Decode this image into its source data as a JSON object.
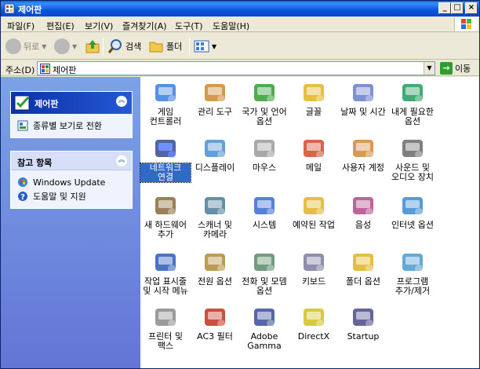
{
  "window": {
    "title": "제어판"
  },
  "menu": [
    "파일(F)",
    "편집(E)",
    "보기(V)",
    "즐겨찾기(A)",
    "도구(T)",
    "도움말(H)"
  ],
  "toolbar": {
    "back": "뒤로",
    "search": "검색",
    "folders": "폴더"
  },
  "address": {
    "label": "주소(D)",
    "value": "제어판",
    "go": "이동"
  },
  "sidebar": {
    "panel1": {
      "title": "제어판",
      "link": "종류별 보기로 전환"
    },
    "panel2": {
      "title": "참고 항목",
      "links": [
        "Windows Update",
        "도움말 및 지원"
      ]
    }
  },
  "items": [
    {
      "label": "게임\n컨트롤러",
      "icon": "game-controller-icon"
    },
    {
      "label": "관리 도구",
      "icon": "admin-tools-icon"
    },
    {
      "label": "국가 및 언어\n옵션",
      "icon": "globe-icon"
    },
    {
      "label": "글꼴",
      "icon": "fonts-folder-icon"
    },
    {
      "label": "날짜 및 시간",
      "icon": "clock-icon"
    },
    {
      "label": "내게 필요한\n옵션",
      "icon": "accessibility-icon"
    },
    {
      "label": "네트워크\n연결",
      "icon": "network-globe-icon",
      "selected": true
    },
    {
      "label": "디스플레이",
      "icon": "display-icon"
    },
    {
      "label": "마우스",
      "icon": "mouse-icon"
    },
    {
      "label": "메일",
      "icon": "mail-icon"
    },
    {
      "label": "사용자 계정",
      "icon": "user-accounts-icon"
    },
    {
      "label": "사운드 및\n오디오 장치",
      "icon": "speaker-icon"
    },
    {
      "label": "새 하드웨어\n추가",
      "icon": "add-hardware-icon"
    },
    {
      "label": "스캐너 및\n카메라",
      "icon": "scanner-icon"
    },
    {
      "label": "시스템",
      "icon": "system-icon"
    },
    {
      "label": "예약된 작업",
      "icon": "scheduled-tasks-icon"
    },
    {
      "label": "음성",
      "icon": "speech-icon"
    },
    {
      "label": "인터넷 옵션",
      "icon": "internet-options-icon"
    },
    {
      "label": "작업 표시줄\n및 시작 메뉴",
      "icon": "taskbar-icon"
    },
    {
      "label": "전원 옵션",
      "icon": "power-icon"
    },
    {
      "label": "전화 및 모뎀\n옵션",
      "icon": "phone-modem-icon"
    },
    {
      "label": "키보드",
      "icon": "keyboard-icon"
    },
    {
      "label": "폴더 옵션",
      "icon": "folder-options-icon"
    },
    {
      "label": "프로그램\n추가/제거",
      "icon": "add-remove-programs-icon"
    },
    {
      "label": "프린터 및\n팩스",
      "icon": "printer-icon"
    },
    {
      "label": "AC3 필터",
      "icon": "ac3-filter-icon"
    },
    {
      "label": "Adobe\nGamma",
      "icon": "adobe-gamma-icon"
    },
    {
      "label": "DirectX",
      "icon": "directx-icon"
    },
    {
      "label": "Startup",
      "icon": "startup-icon"
    }
  ]
}
